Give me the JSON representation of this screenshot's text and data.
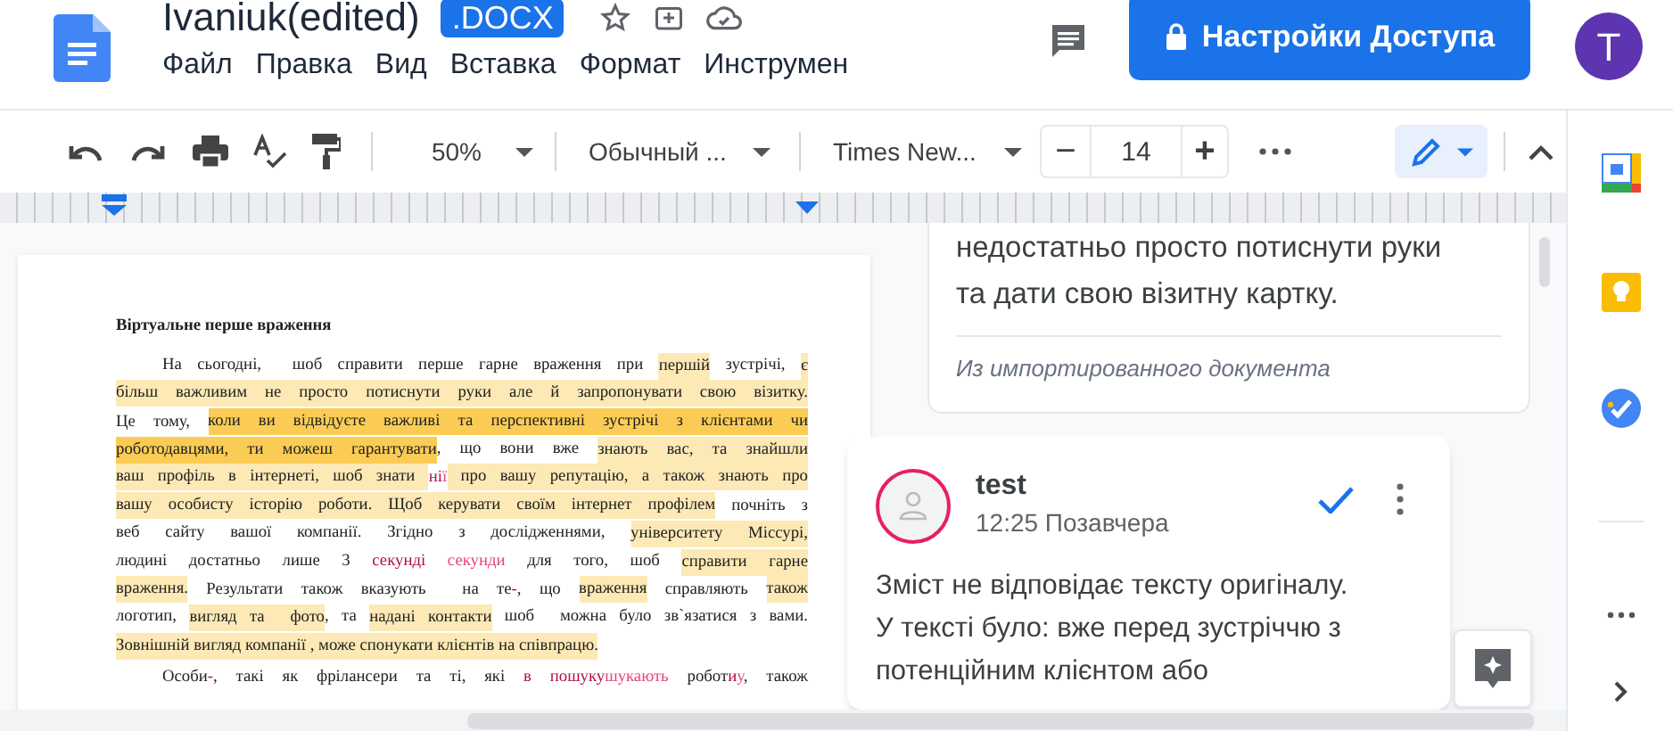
{
  "header": {
    "title": "Ivaniuk(edited)",
    "badge": ".DOCX",
    "menu": [
      "Файл",
      "Правка",
      "Вид",
      "Вставка",
      "Формат",
      "Инструмен"
    ],
    "share_button": "Настройки Доступа",
    "avatar": "T"
  },
  "toolbar": {
    "zoom": "50%",
    "style": "Обычный ...",
    "font": "Times New...",
    "font_size": "14",
    "decrease": "−",
    "increase": "+"
  },
  "document": {
    "title": "Віртуальне перше враження",
    "paragraphs": [
      {
        "lines": [
          [
            {
              "text": "На сьогодні,  шоб справити перше гарне враження при ",
              "kind": "plain"
            },
            {
              "text": "першій",
              "kind": "highlight"
            },
            {
              "text": " зустрічі, ",
              "kind": "plain"
            },
            {
              "text": "є",
              "kind": "highlight"
            }
          ],
          [
            {
              "text": "більш важливим не просто потиснути руки але й запропонувати свою візитку.",
              "kind": "highlight"
            }
          ],
          [
            {
              "text": "Це тому, ",
              "kind": "plain"
            },
            {
              "text": "коли ви відвідуєте важливі та перспективні зустрічі з клієнтами чи",
              "kind": "strong"
            }
          ],
          [
            {
              "text": "роботодавцями, ти можеш гарантувати",
              "kind": "strong"
            },
            {
              "text": ", що вони вже ",
              "kind": "plain"
            },
            {
              "text": "знають вас, та знайшли",
              "kind": "highlight"
            }
          ],
          [
            {
              "text": "ваш профіль в інтернеті, шоб знати ",
              "kind": "highlight"
            },
            {
              "text": "ні",
              "kind": "deleted"
            },
            {
              "text": "ї",
              "kind": "inserted"
            },
            {
              "text": " про вашу репутацію, а також знають про",
              "kind": "highlight"
            }
          ],
          [
            {
              "text": "вашу особисту історію роботи.",
              "kind": "highlight"
            },
            {
              "text": " Щоб керувати своїм інтернет профілем",
              "kind": "highlight"
            },
            {
              "text": " почніть з",
              "kind": "plain"
            }
          ],
          [
            {
              "text": "веб сайту вашої компанії. Згідно з дослідженнями, ",
              "kind": "plain"
            },
            {
              "text": "університету Міссурі,",
              "kind": "highlight"
            }
          ],
          [
            {
              "text": "людині достатньо лише 3 ",
              "kind": "plain"
            },
            {
              "text": "секунді",
              "kind": "deleted"
            },
            {
              "text": " секунди",
              "kind": "inserted"
            },
            {
              "text": " для того, шоб ",
              "kind": "plain"
            },
            {
              "text": "справити гарне",
              "kind": "highlight"
            }
          ],
          [
            {
              "text": "враження.",
              "kind": "highlight"
            },
            {
              "text": " Результати також вказують  на те",
              "kind": "plain"
            },
            {
              "text": "-",
              "kind": "deleted"
            },
            {
              "text": ", що ",
              "kind": "plain"
            },
            {
              "text": "враження",
              "kind": "highlight"
            },
            {
              "text": " справляють ",
              "kind": "plain"
            },
            {
              "text": "також",
              "kind": "highlight"
            }
          ],
          [
            {
              "text": "логотип, ",
              "kind": "plain"
            },
            {
              "text": "вигляд та  фото",
              "kind": "highlight"
            },
            {
              "text": ", та ",
              "kind": "plain"
            },
            {
              "text": "надані контакти",
              "kind": "highlight"
            },
            {
              "text": " шоб  можна було зв`язатися з вами.",
              "kind": "plain"
            }
          ],
          [
            {
              "text": "Зовнішній вигляд компанії , може спонукати клієнтів на співпрацю.",
              "kind": "highlight"
            }
          ]
        ]
      },
      {
        "lines": [
          [
            {
              "text": "Особи",
              "kind": "plain"
            },
            {
              "text": "-",
              "kind": "deleted"
            },
            {
              "text": ", такі як фрілансери та ті, які ",
              "kind": "plain"
            },
            {
              "text": "в пошуку",
              "kind": "deleted"
            },
            {
              "text": "шукають",
              "kind": "inserted"
            },
            {
              "text": " робот",
              "kind": "plain"
            },
            {
              "text": "и",
              "kind": "deleted"
            },
            {
              "text": "у",
              "kind": "inserted"
            },
            {
              "text": ", також",
              "kind": "plain"
            }
          ]
        ]
      }
    ]
  },
  "comments": [
    {
      "kind": "imported",
      "lines": [
        "недостатньо просто потиснути руки",
        "та дати свою візитну картку."
      ],
      "source": "Из импортированного документа"
    },
    {
      "kind": "user",
      "author": "test",
      "time": "12:25 Позавчера",
      "lines": [
        "Зміст не відповідає тексту оригіналу.",
        "У тексті було: вже перед зустріччю з",
        "потенційним клієнтом або"
      ]
    }
  ]
}
